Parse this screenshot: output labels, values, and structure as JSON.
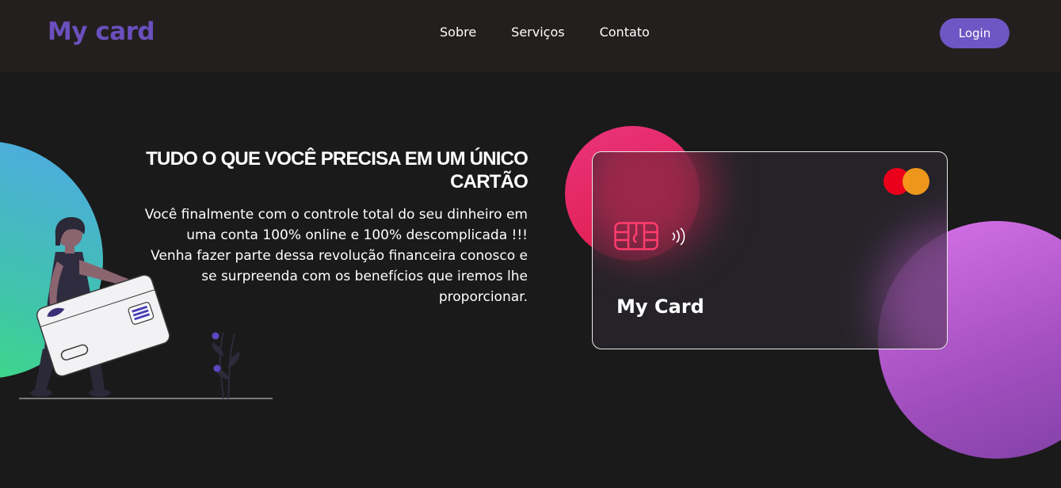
{
  "header": {
    "logo": "My card",
    "nav": [
      "Sobre",
      "Serviços",
      "Contato"
    ],
    "login_label": "Login"
  },
  "hero": {
    "title_line1": "TUDO O QUE VOCÊ PRECISA EM UM ÚNICO",
    "title_line2": "CARTÃO",
    "desc_line1": "Você finalmente com o controle total do seu dinheiro em",
    "desc_line2": "uma conta 100% online e 100% descomplicada !!!",
    "desc_line3": "Venha fazer parte dessa revolução financeira conosco e",
    "desc_line4": "se surpreenda com os benefícios que iremos lhe",
    "desc_line5": "proporcionar."
  },
  "card": {
    "label": "My Card"
  },
  "icons": {
    "card_brand": "mastercard-logo-icon",
    "chip": "card-chip-icon",
    "contactless": "contactless-icon"
  },
  "colors": {
    "accent": "#6e56c4",
    "logo": "#6b4fbd",
    "header_bg": "#231f1e",
    "page_bg": "#1a1a1a"
  }
}
